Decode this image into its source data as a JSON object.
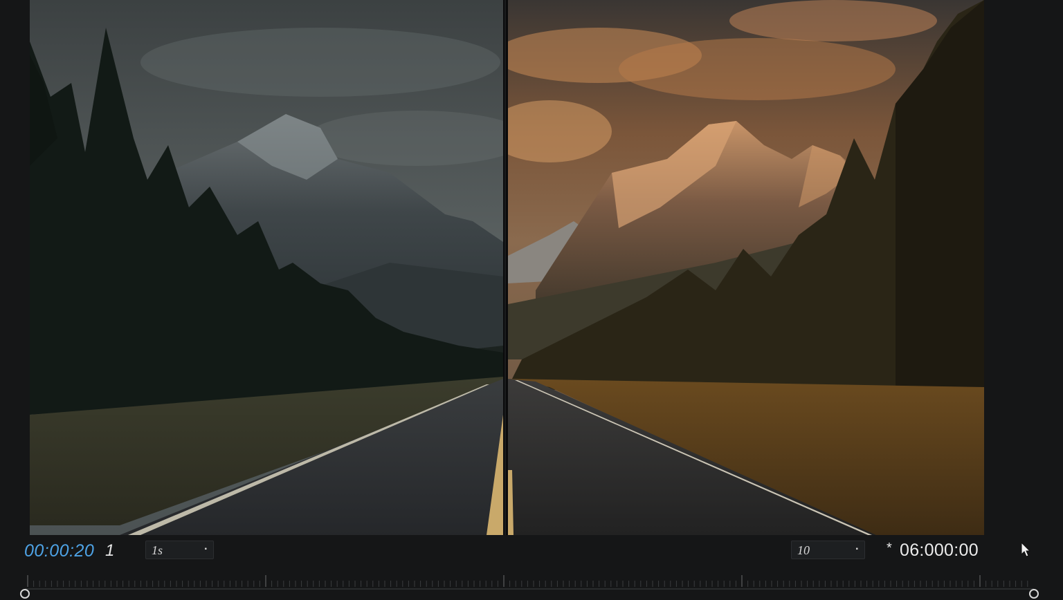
{
  "viewer": {
    "left_label": "",
    "right_label": ""
  },
  "transport": {
    "current_timecode": "00:00:20",
    "frame_number": "1",
    "zoom_value": "1s",
    "quality_value": "10",
    "duration_marker": "*",
    "duration": "06:000:00"
  },
  "colors": {
    "timecode": "#4ea3e6",
    "background": "#151617"
  },
  "icons": {
    "cursor": "cursor-arrow-icon",
    "dropdown": "caret-icon",
    "playhead_start": "circle-handle-icon",
    "playhead_end": "circle-handle-icon"
  }
}
